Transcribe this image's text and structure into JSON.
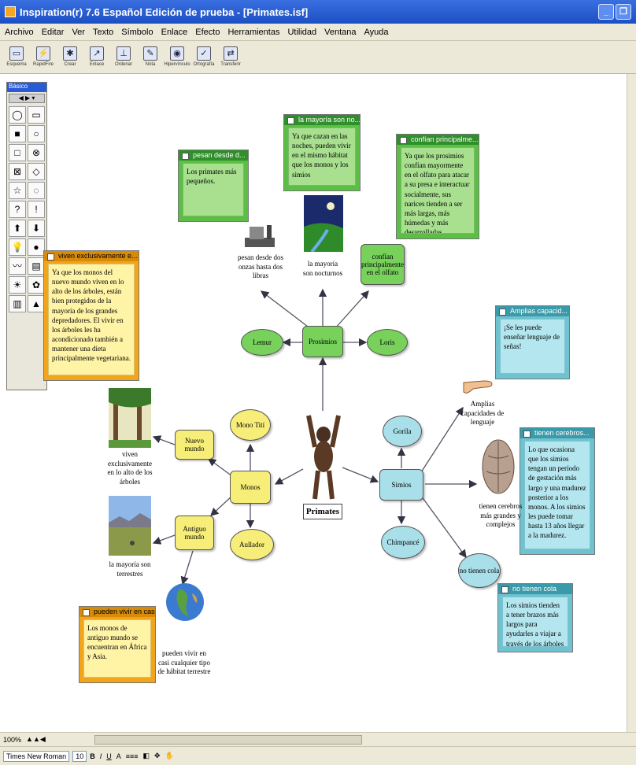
{
  "window": {
    "title": "Inspiration(r) 7.6 Español Edición de prueba - [Primates.isf]"
  },
  "menu": [
    "Archivo",
    "Editar",
    "Ver",
    "Texto",
    "Símbolo",
    "Enlace",
    "Efecto",
    "Herramientas",
    "Utilidad",
    "Ventana",
    "Ayuda"
  ],
  "toolbar": [
    {
      "label": "Esquema",
      "icon": "outline-icon"
    },
    {
      "label": "RapidFire",
      "icon": "rapidfire-icon"
    },
    {
      "label": "Crear",
      "icon": "create-icon"
    },
    {
      "label": "Enlace",
      "icon": "link-icon"
    },
    {
      "label": "Ordenar",
      "icon": "arrange-icon"
    },
    {
      "label": "Nota",
      "icon": "note-icon"
    },
    {
      "label": "Hipervínculo",
      "icon": "hyperlink-icon"
    },
    {
      "label": "Ortografía",
      "icon": "spellcheck-icon"
    },
    {
      "label": "Transferir",
      "icon": "transfer-icon"
    }
  ],
  "palette": {
    "title": "Básico"
  },
  "nodes": {
    "central": "Primates",
    "prosimios": "Prosimios",
    "lemur": "Lemur",
    "loris": "Loris",
    "monos": "Monos",
    "mono_titi": "Mono Tití",
    "nuevo_mundo": "Nuevo mundo",
    "antiguo_mundo": "Antiguo mundo",
    "aullador": "Aullador",
    "simios": "Simios",
    "gorila": "Gorila",
    "chimpance": "Chimpancé",
    "no_tienen_cola": "no tienen cola",
    "confian_node": "confían principalmente en el olfato"
  },
  "labels": {
    "pesan": "pesan desde dos onzas hasta dos libras",
    "nocturnos": "la mayoría son nocturnos",
    "viven": "viven exclusivamente en lo alto de los árboles",
    "terrestres": "la mayoría son terrestres",
    "habitat": "pueden vivir en casi cualquier tipo de hábitat terrestre",
    "lenguaje": "Amplias capacidades de lenguaje",
    "cerebros": "tienen cerebros más grandes y complejos"
  },
  "notes": {
    "pesan": {
      "title": "pesan desde d...",
      "body": "Los primates más pequeños."
    },
    "nocturnos": {
      "title": "la mayoría son no...",
      "body": "Ya que cazan en las noches, pueden vivir en el mismo hábitat que los monos y los simios"
    },
    "confian": {
      "title": "confían principalme...",
      "body": "Ya que los prosimios confían mayormente en el olfato para atacar a su presa e interactuar socialmente, sus narices tienden a ser más largas, más húmedas y más desarrolladas"
    },
    "viven": {
      "title": "viven exclusivamente e...",
      "body": "Ya que los monos del nuevo mundo viven en lo alto de los árboles, están bien protegidos de la mayoría de los grandes depredadores. El vivir en los árboles les ha acondicionado también a mantener una dieta principalmente vegetariana."
    },
    "lenguaje": {
      "title": "Amplias capacid...",
      "body": "¡Se les puede enseñar lenguaje de señas!"
    },
    "cerebros": {
      "title": "tienen cerebros...",
      "body": "Lo que ocasiona que los simios tengan un período de gestación más largo y una madurez posterior a los monos. A los simios les puede tomar hasta 13 años llegar a la madurez."
    },
    "cola": {
      "title": "no tienen cola",
      "body": "Los simios tienden a tener brazos más largos para ayudarles a viajar a través de los árboles"
    },
    "habitat": {
      "title": "pueden vivir en cas...",
      "body": "Los monos de antiguo mundo se encuentran en África y Asia."
    }
  },
  "statusbar": {
    "zoom": "100%",
    "font": "Times New Roman",
    "size": "10"
  }
}
